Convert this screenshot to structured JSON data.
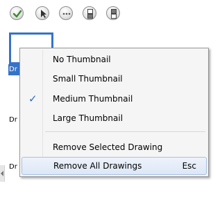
{
  "toolbar": {
    "buttons": [
      {
        "icon": "checkmark-icon"
      },
      {
        "icon": "pointer-icon"
      },
      {
        "icon": "ellipsis-icon"
      },
      {
        "icon": "bring-forward-icon"
      },
      {
        "icon": "send-backward-icon"
      }
    ]
  },
  "panel": {
    "items": [
      {
        "label": "Dr"
      },
      {
        "label": "Dr"
      },
      {
        "label": "Dr"
      }
    ]
  },
  "context_menu": {
    "items": [
      {
        "label": "No Thumbnail",
        "checked": false
      },
      {
        "label": "Small Thumbnail",
        "checked": false
      },
      {
        "label": "Medium Thumbnail",
        "checked": true
      },
      {
        "label": "Large Thumbnail",
        "checked": false
      },
      {
        "label": "Remove Selected Drawing",
        "checked": false
      },
      {
        "label": "Remove All Drawings",
        "shortcut": "Esc",
        "checked": false
      }
    ],
    "check_glyph": "✓",
    "highlighted_item": "Remove All Drawings"
  },
  "colors": {
    "selection": "#3573c8",
    "menu_background": "#f5f5f5",
    "hover_border": "#a6c0e6",
    "check": "#2a6ac6"
  }
}
